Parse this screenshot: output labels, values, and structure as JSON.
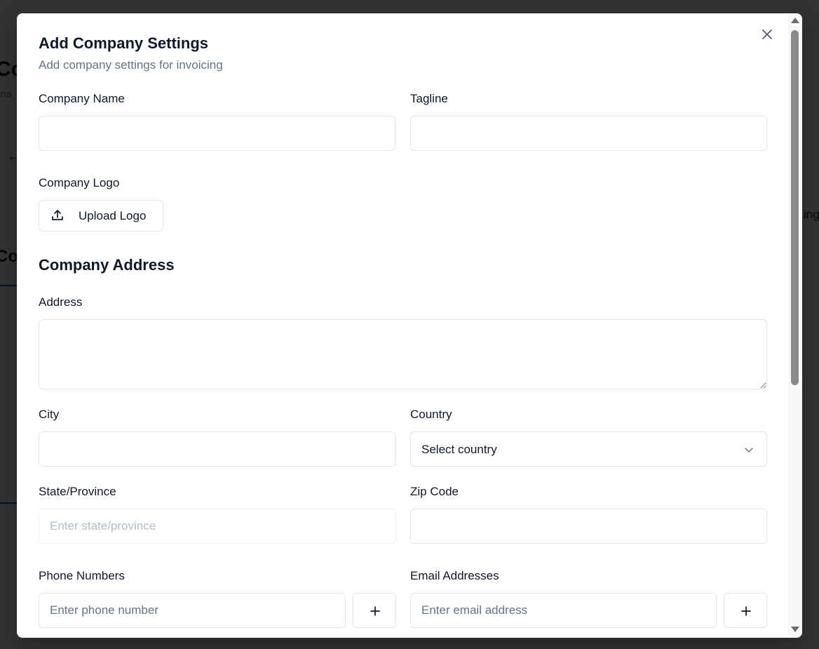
{
  "background": {
    "title": "Co",
    "subtitle": "ana",
    "section": "Co",
    "button_text": "ing"
  },
  "modal": {
    "title": "Add Company Settings",
    "description": "Add company settings for invoicing",
    "close_icon": "close-icon",
    "fields": {
      "company_name": {
        "label": "Company Name",
        "value": ""
      },
      "tagline": {
        "label": "Tagline",
        "value": ""
      },
      "company_logo": {
        "label": "Company Logo",
        "button": "Upload Logo"
      },
      "address_section": "Company Address",
      "address": {
        "label": "Address",
        "value": ""
      },
      "city": {
        "label": "City",
        "value": ""
      },
      "country": {
        "label": "Country",
        "selected": "Select country"
      },
      "state": {
        "label": "State/Province",
        "placeholder": "Enter state/province"
      },
      "zip": {
        "label": "Zip Code",
        "value": ""
      },
      "phone": {
        "label": "Phone Numbers",
        "placeholder": "Enter phone number"
      },
      "email": {
        "label": "Email Addresses",
        "placeholder": "Enter email address"
      }
    }
  },
  "colors": {
    "text": "#0f172a",
    "muted": "#64748b",
    "border": "#e2e8f0",
    "overlay": "rgba(0,0,0,0.8)"
  }
}
